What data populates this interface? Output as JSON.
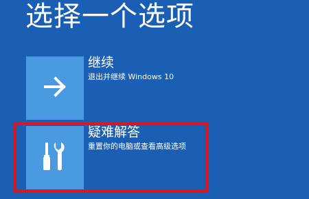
{
  "page": {
    "title": "选择一个选项"
  },
  "options": [
    {
      "title": "继续",
      "description": "退出并继续 Windows 10",
      "icon": "arrow-right-icon"
    },
    {
      "title": "疑难解答",
      "description": "重置你的电脑或查看高级选项",
      "icon": "tools-icon"
    }
  ],
  "colors": {
    "background": "#1a5fb4",
    "tile": "#4a9ae2",
    "highlight": "#e3141b",
    "text": "#ffffff"
  }
}
